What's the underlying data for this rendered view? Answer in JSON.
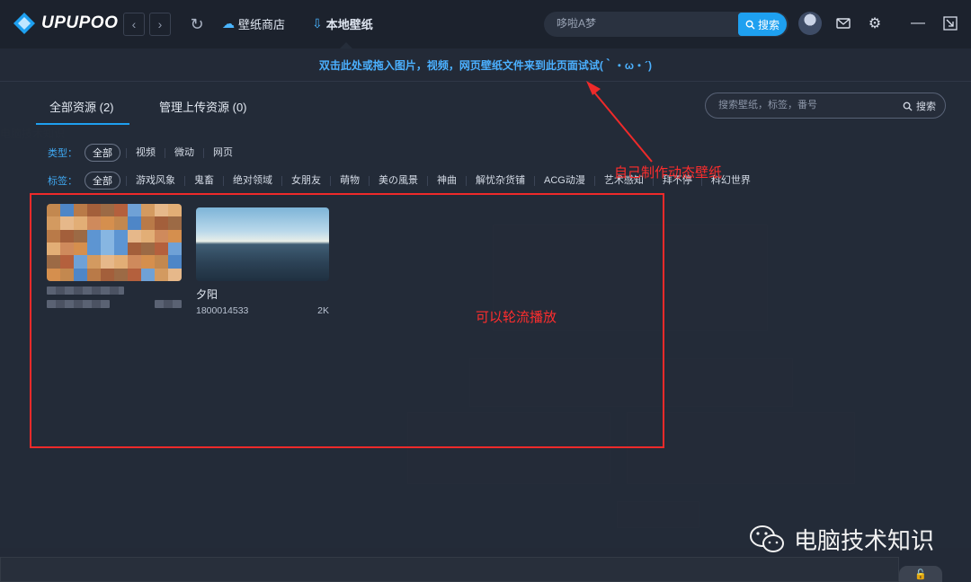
{
  "app": {
    "logo_text": "UPUPOO"
  },
  "topbar": {
    "back_icon": "chevron-left-icon",
    "forward_icon": "chevron-right-icon",
    "refresh_icon": "refresh-icon",
    "nav": [
      {
        "label": "壁纸商店",
        "icon": "cloud-icon"
      },
      {
        "label": "本地壁纸",
        "icon": "download-icon",
        "active": true
      }
    ],
    "search_placeholder": "哆啦A梦",
    "search_button": "搜索",
    "icons": [
      "avatar",
      "mail-icon",
      "gear-icon",
      "minimize-icon",
      "shrink-window-icon"
    ]
  },
  "hint": "双击此处或拖入图片，视频，网页壁纸文件来到此页面试试(｀・ω・´)",
  "tabs": [
    {
      "label": "全部资源 (2)",
      "active": true
    },
    {
      "label": "管理上传资源 (0)",
      "active": false
    }
  ],
  "panel_search": {
    "placeholder": "搜索壁纸，标签，番号",
    "button": "搜索"
  },
  "filters": {
    "type_label": "类型：",
    "type_active": "全部",
    "types": [
      "视频",
      "微动",
      "网页"
    ],
    "tag_label": "标签：",
    "tag_active": "全部",
    "tags": [
      "游戏风象",
      "鬼畜",
      "绝对领域",
      "女朋友",
      "萌物",
      "美の風景",
      "神曲",
      "解忧杂货铺",
      "ACG动漫",
      "艺术感知",
      "拜不停",
      "科幻世界"
    ]
  },
  "cards": [
    {
      "title": "",
      "id": "",
      "resolution": "",
      "blurred": true
    },
    {
      "title": "夕阳",
      "id": "1800014533",
      "resolution": "2K",
      "blurred": false
    }
  ],
  "annotations": {
    "make_wallpaper": "自己制作动态壁纸",
    "rotate_play": "可以轮流播放"
  },
  "watermark": "电脑技术知识",
  "colors": {
    "accent": "#1ea0f0",
    "annotation": "#ee2a2a",
    "background": "#232a37"
  }
}
